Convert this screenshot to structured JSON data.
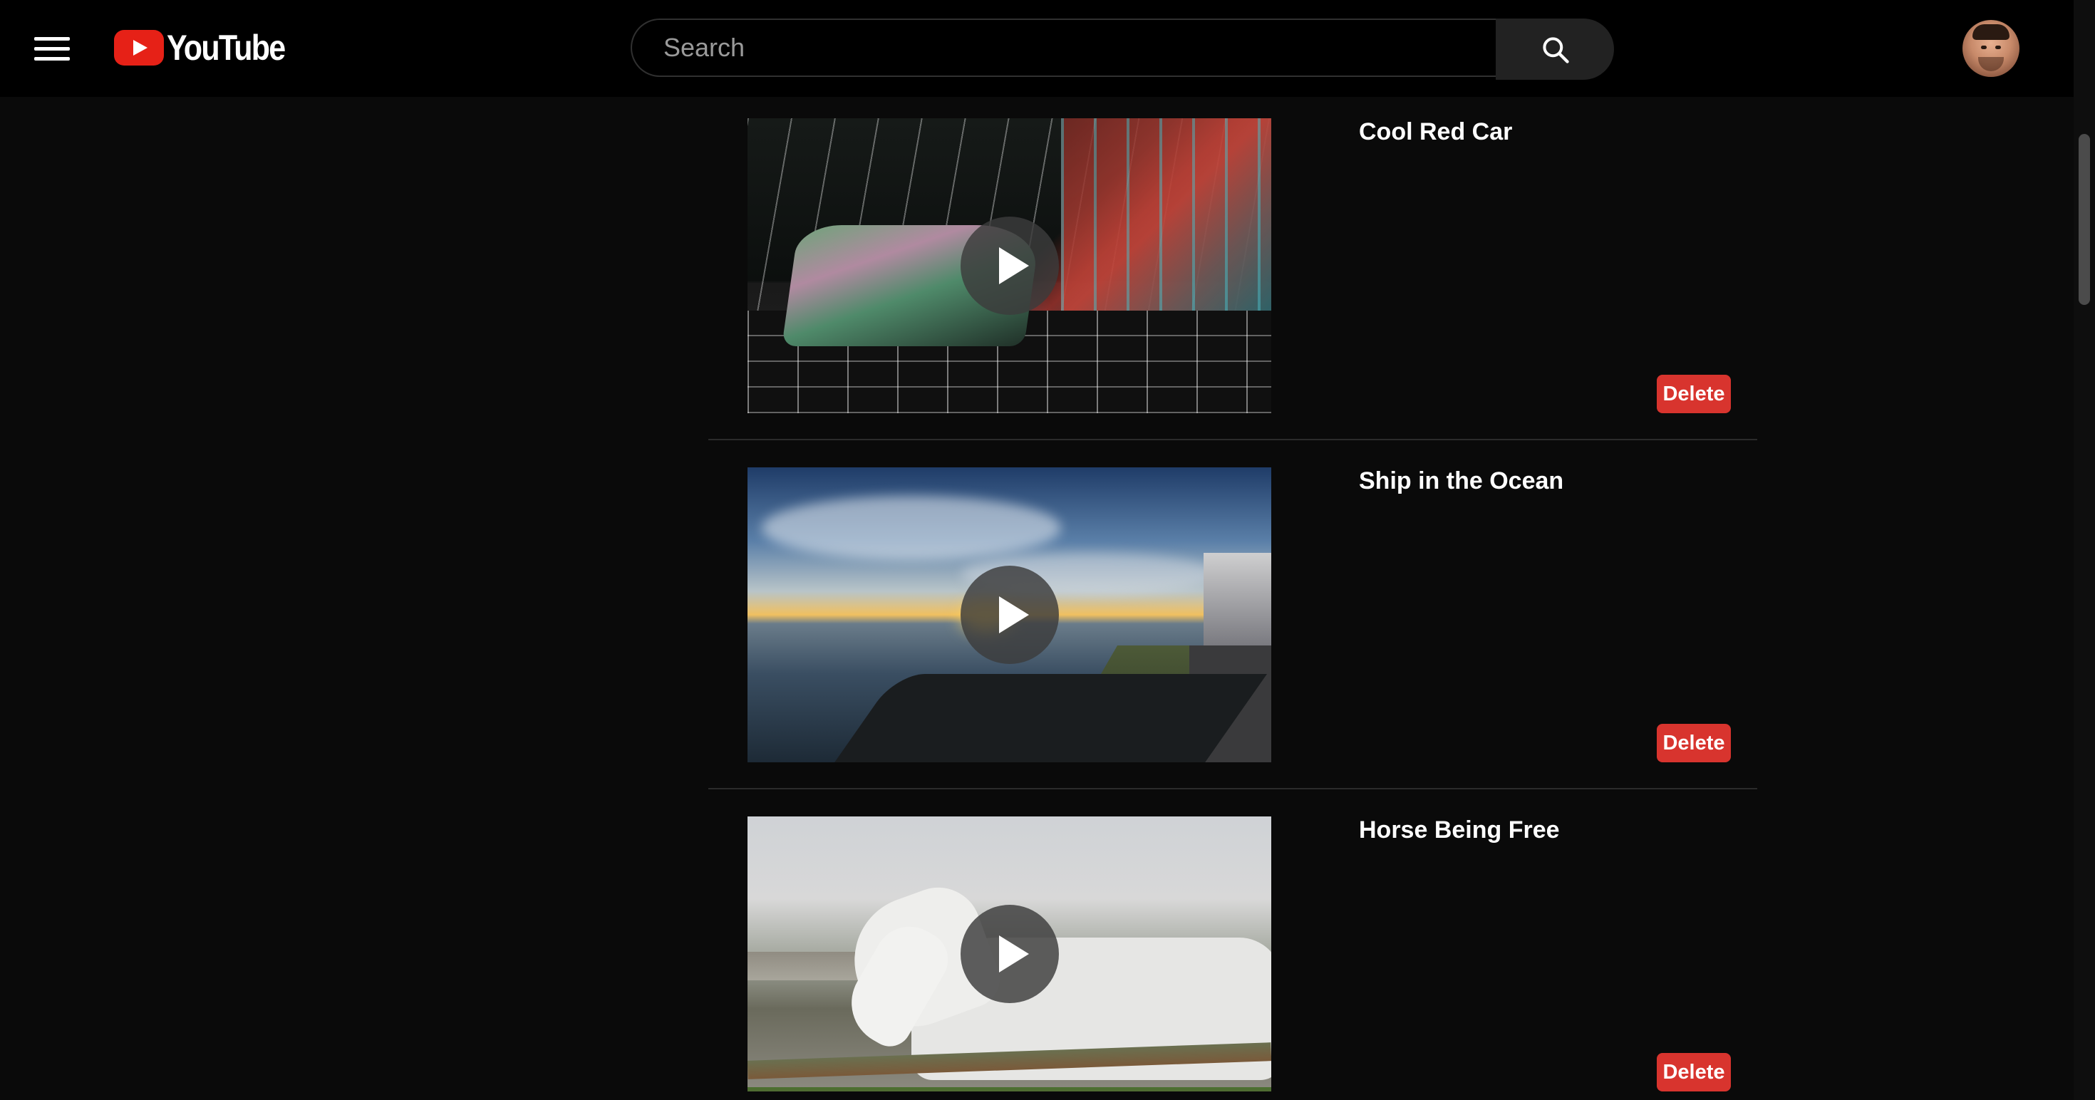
{
  "app": {
    "brand_name": "YouTube",
    "accent_color": "#e62117",
    "background_color": "#0a0a0a"
  },
  "header": {
    "menu_icon": "hamburger-menu-icon",
    "search": {
      "placeholder": "Search",
      "value": "",
      "icon": "search-icon"
    },
    "avatar_icon": "user-avatar"
  },
  "videos": [
    {
      "title": "Cool Red Car",
      "delete_label": "Delete",
      "thumbnail": "car-thumbnail"
    },
    {
      "title": "Ship in the Ocean",
      "delete_label": "Delete",
      "thumbnail": "ocean-sunset-thumbnail"
    },
    {
      "title": "Horse Being Free",
      "delete_label": "Delete",
      "thumbnail": "white-horse-thumbnail"
    }
  ],
  "delete_button_color": "#d8342e"
}
